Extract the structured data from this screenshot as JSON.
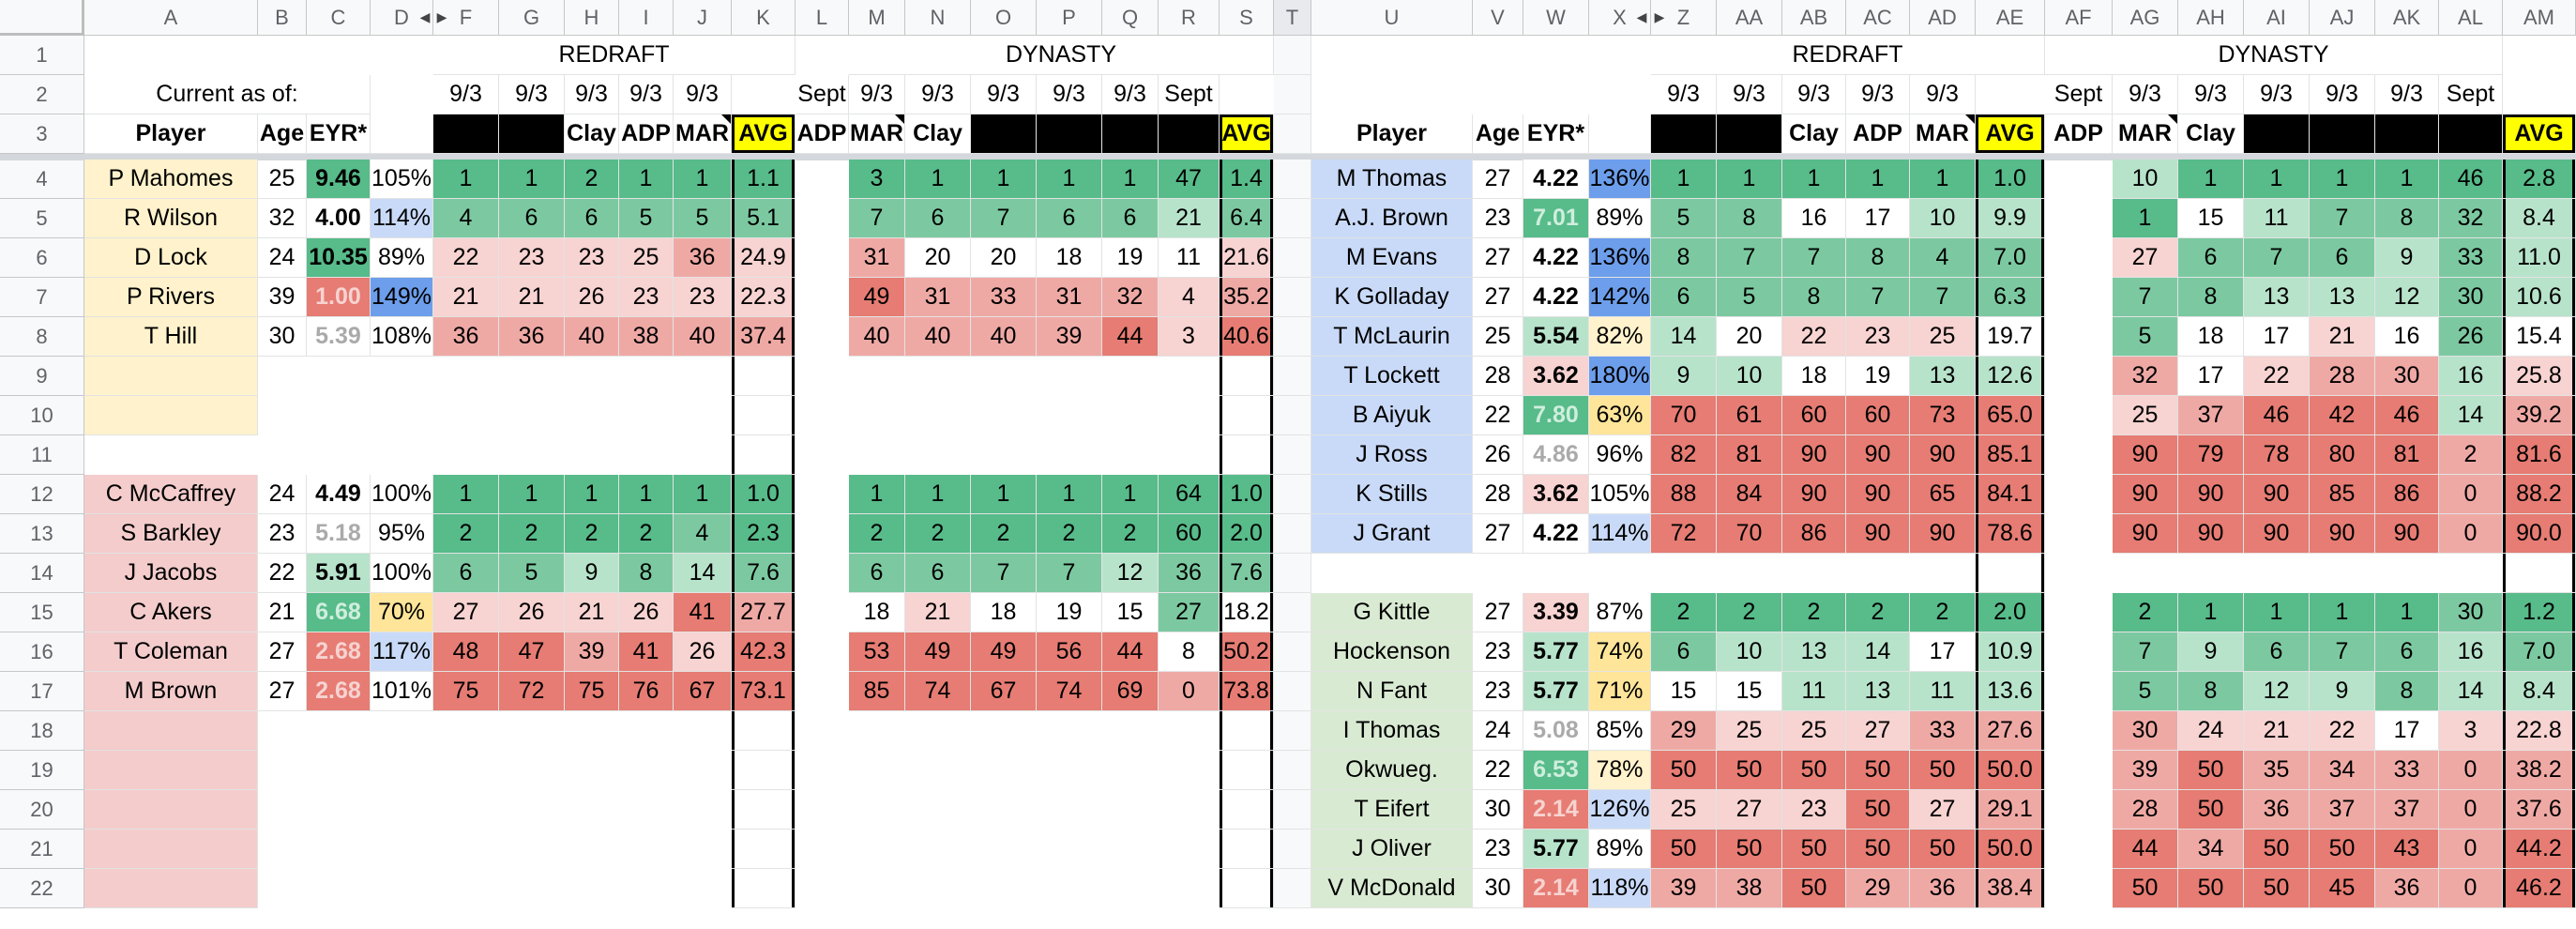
{
  "colors": {
    "green_dark": "#57bb8a",
    "green_mid": "#7cc9a1",
    "green_light": "#b8e3cb",
    "white": "#ffffff",
    "red_light": "#f7d3d1",
    "red_mid": "#efa9a5",
    "red_dark": "#e67c73",
    "qb_bg": "#fff2cc",
    "rb_bg": "#f4cccc",
    "wr_bg": "#c9daf8",
    "te_bg": "#d9ead3",
    "avg_yellow": "#ffff00",
    "black": "#000000",
    "pct_blue": "#6d9eeb",
    "pct_lblue": "#c9daf8",
    "pct_yellow": "#ffe599",
    "pct_lyellow": "#fff2cc"
  },
  "cols_left": [
    "A",
    "B",
    "C",
    "D",
    "F",
    "G",
    "H",
    "I",
    "J",
    "K",
    "L",
    "M",
    "N",
    "O",
    "P",
    "Q",
    "R",
    "S",
    "T"
  ],
  "cols_right": [
    "U",
    "V",
    "W",
    "X",
    "Z",
    "AA",
    "AB",
    "AC",
    "AD",
    "AE",
    "AF",
    "AG",
    "AH",
    "AI",
    "AJ",
    "AK",
    "AL",
    "AM"
  ],
  "row_numbers": [
    "1",
    "2",
    "3",
    "4",
    "5",
    "6",
    "7",
    "8",
    "9",
    "10",
    "11",
    "12",
    "13",
    "14",
    "15",
    "16",
    "17",
    "18",
    "19",
    "20",
    "21",
    "22"
  ],
  "headers": {
    "redraft": "REDRAFT",
    "dynasty": "DYNASTY",
    "current_as_of": "Current as of:",
    "player": "Player",
    "age": "Age",
    "eyr": "EYR*",
    "date": "9/3",
    "sept": "Sept",
    "clay": "Clay",
    "adp": "ADP",
    "mar": "MAR",
    "avg": "AVG"
  },
  "left_players": [
    {
      "row": 4,
      "name": "P Mahomes",
      "age": "25",
      "eyr": "9.46",
      "pct": "105%",
      "r": [
        "1",
        "1",
        "2",
        "1",
        "1"
      ],
      "ravg": "1.1",
      "d": [
        "3",
        "1",
        "1",
        "1",
        "1",
        "47"
      ],
      "davg": "1.4"
    },
    {
      "row": 5,
      "name": "R Wilson",
      "age": "32",
      "eyr": "4.00",
      "pct": "114%",
      "r": [
        "4",
        "6",
        "6",
        "5",
        "5"
      ],
      "ravg": "5.1",
      "d": [
        "7",
        "6",
        "7",
        "6",
        "6",
        "21"
      ],
      "davg": "6.4"
    },
    {
      "row": 6,
      "name": "D Lock",
      "age": "24",
      "eyr": "10.35",
      "pct": "89%",
      "r": [
        "22",
        "23",
        "23",
        "25",
        "36"
      ],
      "ravg": "24.9",
      "d": [
        "31",
        "20",
        "20",
        "18",
        "19",
        "11"
      ],
      "davg": "21.6"
    },
    {
      "row": 7,
      "name": "P Rivers",
      "age": "39",
      "eyr": "1.00",
      "pct": "149%",
      "r": [
        "21",
        "21",
        "26",
        "23",
        "23"
      ],
      "ravg": "22.3",
      "d": [
        "49",
        "31",
        "33",
        "31",
        "32",
        "4"
      ],
      "davg": "35.2"
    },
    {
      "row": 8,
      "name": "T Hill",
      "age": "30",
      "eyr": "5.39",
      "pct": "108%",
      "r": [
        "36",
        "36",
        "40",
        "38",
        "40"
      ],
      "ravg": "37.4",
      "d": [
        "40",
        "40",
        "40",
        "39",
        "44",
        "3"
      ],
      "davg": "40.6"
    },
    {
      "row": 12,
      "name": "C McCaffrey",
      "age": "24",
      "eyr": "4.49",
      "pct": "100%",
      "r": [
        "1",
        "1",
        "1",
        "1",
        "1"
      ],
      "ravg": "1.0",
      "d": [
        "1",
        "1",
        "1",
        "1",
        "1",
        "64"
      ],
      "davg": "1.0"
    },
    {
      "row": 13,
      "name": "S Barkley",
      "age": "23",
      "eyr": "5.18",
      "pct": "95%",
      "r": [
        "2",
        "2",
        "2",
        "2",
        "4"
      ],
      "ravg": "2.3",
      "d": [
        "2",
        "2",
        "2",
        "2",
        "2",
        "60"
      ],
      "davg": "2.0"
    },
    {
      "row": 14,
      "name": "J Jacobs",
      "age": "22",
      "eyr": "5.91",
      "pct": "100%",
      "r": [
        "6",
        "5",
        "9",
        "8",
        "14"
      ],
      "ravg": "7.6",
      "d": [
        "6",
        "6",
        "7",
        "7",
        "12",
        "36"
      ],
      "davg": "7.6"
    },
    {
      "row": 15,
      "name": "C Akers",
      "age": "21",
      "eyr": "6.68",
      "pct": "70%",
      "r": [
        "27",
        "26",
        "21",
        "26",
        "41"
      ],
      "ravg": "27.7",
      "d": [
        "18",
        "21",
        "18",
        "19",
        "15",
        "27"
      ],
      "davg": "18.2"
    },
    {
      "row": 16,
      "name": "T Coleman",
      "age": "27",
      "eyr": "2.68",
      "pct": "117%",
      "r": [
        "48",
        "47",
        "39",
        "41",
        "26"
      ],
      "ravg": "42.3",
      "d": [
        "53",
        "49",
        "49",
        "56",
        "44",
        "8"
      ],
      "davg": "50.2"
    },
    {
      "row": 17,
      "name": "M Brown",
      "age": "27",
      "eyr": "2.68",
      "pct": "101%",
      "r": [
        "75",
        "72",
        "75",
        "76",
        "67"
      ],
      "ravg": "73.1",
      "d": [
        "85",
        "74",
        "67",
        "74",
        "69",
        "0"
      ],
      "davg": "73.8"
    }
  ],
  "right_players": [
    {
      "row": 4,
      "name": "M Thomas",
      "age": "27",
      "eyr": "4.22",
      "pct": "136%",
      "r": [
        "1",
        "1",
        "1",
        "1",
        "1"
      ],
      "ravg": "1.0",
      "d": [
        "10",
        "1",
        "1",
        "1",
        "1",
        "46"
      ],
      "davg": "2.8"
    },
    {
      "row": 5,
      "name": "A.J. Brown",
      "age": "23",
      "eyr": "7.01",
      "pct": "89%",
      "r": [
        "5",
        "8",
        "16",
        "17",
        "10"
      ],
      "ravg": "9.9",
      "d": [
        "1",
        "15",
        "11",
        "7",
        "8",
        "32"
      ],
      "davg": "8.4"
    },
    {
      "row": 6,
      "name": "M Evans",
      "age": "27",
      "eyr": "4.22",
      "pct": "136%",
      "r": [
        "8",
        "7",
        "7",
        "8",
        "4"
      ],
      "ravg": "7.0",
      "d": [
        "27",
        "6",
        "7",
        "6",
        "9",
        "33"
      ],
      "davg": "11.0"
    },
    {
      "row": 7,
      "name": "K Golladay",
      "age": "27",
      "eyr": "4.22",
      "pct": "142%",
      "r": [
        "6",
        "5",
        "8",
        "7",
        "7"
      ],
      "ravg": "6.3",
      "d": [
        "7",
        "8",
        "13",
        "13",
        "12",
        "30"
      ],
      "davg": "10.6"
    },
    {
      "row": 8,
      "name": "T McLaurin",
      "age": "25",
      "eyr": "5.54",
      "pct": "82%",
      "r": [
        "14",
        "20",
        "22",
        "23",
        "25"
      ],
      "ravg": "19.7",
      "d": [
        "5",
        "18",
        "17",
        "21",
        "16",
        "26"
      ],
      "davg": "15.4"
    },
    {
      "row": 9,
      "name": "T Lockett",
      "age": "28",
      "eyr": "3.62",
      "pct": "180%",
      "r": [
        "9",
        "10",
        "18",
        "19",
        "13"
      ],
      "ravg": "12.6",
      "d": [
        "32",
        "17",
        "22",
        "28",
        "30",
        "16"
      ],
      "davg": "25.8"
    },
    {
      "row": 10,
      "name": "B Aiyuk",
      "age": "22",
      "eyr": "7.80",
      "pct": "63%",
      "r": [
        "70",
        "61",
        "60",
        "60",
        "73"
      ],
      "ravg": "65.0",
      "d": [
        "25",
        "37",
        "46",
        "42",
        "46",
        "14"
      ],
      "davg": "39.2"
    },
    {
      "row": 11,
      "name": "J Ross",
      "age": "26",
      "eyr": "4.86",
      "pct": "96%",
      "r": [
        "82",
        "81",
        "90",
        "90",
        "90"
      ],
      "ravg": "85.1",
      "d": [
        "90",
        "79",
        "78",
        "80",
        "81",
        "2"
      ],
      "davg": "81.6"
    },
    {
      "row": 12,
      "name": "K Stills",
      "age": "28",
      "eyr": "3.62",
      "pct": "105%",
      "r": [
        "88",
        "84",
        "90",
        "90",
        "65"
      ],
      "ravg": "84.1",
      "d": [
        "90",
        "90",
        "90",
        "85",
        "86",
        "0"
      ],
      "davg": "88.2"
    },
    {
      "row": 13,
      "name": "J Grant",
      "age": "27",
      "eyr": "4.22",
      "pct": "114%",
      "r": [
        "72",
        "70",
        "86",
        "90",
        "90"
      ],
      "ravg": "78.6",
      "d": [
        "90",
        "90",
        "90",
        "90",
        "90",
        "0"
      ],
      "davg": "90.0"
    },
    {
      "row": 15,
      "name": "G Kittle",
      "age": "27",
      "eyr": "3.39",
      "pct": "87%",
      "r": [
        "2",
        "2",
        "2",
        "2",
        "2"
      ],
      "ravg": "2.0",
      "d": [
        "2",
        "1",
        "1",
        "1",
        "1",
        "30"
      ],
      "davg": "1.2"
    },
    {
      "row": 16,
      "name": "Hockenson",
      "age": "23",
      "eyr": "5.77",
      "pct": "74%",
      "r": [
        "6",
        "10",
        "13",
        "14",
        "17"
      ],
      "ravg": "10.9",
      "d": [
        "7",
        "9",
        "6",
        "7",
        "6",
        "16"
      ],
      "davg": "7.0"
    },
    {
      "row": 17,
      "name": "N Fant",
      "age": "23",
      "eyr": "5.77",
      "pct": "71%",
      "r": [
        "15",
        "15",
        "11",
        "13",
        "11"
      ],
      "ravg": "13.6",
      "d": [
        "5",
        "8",
        "12",
        "9",
        "8",
        "14"
      ],
      "davg": "8.4"
    },
    {
      "row": 18,
      "name": "I Thomas",
      "age": "24",
      "eyr": "5.08",
      "pct": "85%",
      "r": [
        "29",
        "25",
        "25",
        "27",
        "33"
      ],
      "ravg": "27.6",
      "d": [
        "30",
        "24",
        "21",
        "22",
        "17",
        "3"
      ],
      "davg": "22.8"
    },
    {
      "row": 19,
      "name": "Okwueg.",
      "age": "22",
      "eyr": "6.53",
      "pct": "78%",
      "r": [
        "50",
        "50",
        "50",
        "50",
        "50"
      ],
      "ravg": "50.0",
      "d": [
        "39",
        "50",
        "35",
        "34",
        "33",
        "0"
      ],
      "davg": "38.2"
    },
    {
      "row": 20,
      "name": "T Eifert",
      "age": "30",
      "eyr": "2.14",
      "pct": "126%",
      "r": [
        "25",
        "27",
        "23",
        "50",
        "27"
      ],
      "ravg": "29.1",
      "d": [
        "28",
        "50",
        "36",
        "37",
        "37",
        "0"
      ],
      "davg": "37.6"
    },
    {
      "row": 21,
      "name": "J Oliver",
      "age": "23",
      "eyr": "5.77",
      "pct": "89%",
      "r": [
        "50",
        "50",
        "50",
        "50",
        "50"
      ],
      "ravg": "50.0",
      "d": [
        "44",
        "34",
        "50",
        "50",
        "43",
        "0"
      ],
      "davg": "44.2"
    },
    {
      "row": 22,
      "name": "V McDonald",
      "age": "30",
      "eyr": "2.14",
      "pct": "118%",
      "r": [
        "39",
        "38",
        "50",
        "29",
        "36"
      ],
      "ravg": "38.4",
      "d": [
        "50",
        "50",
        "50",
        "45",
        "36",
        "0"
      ],
      "davg": "46.2"
    }
  ]
}
